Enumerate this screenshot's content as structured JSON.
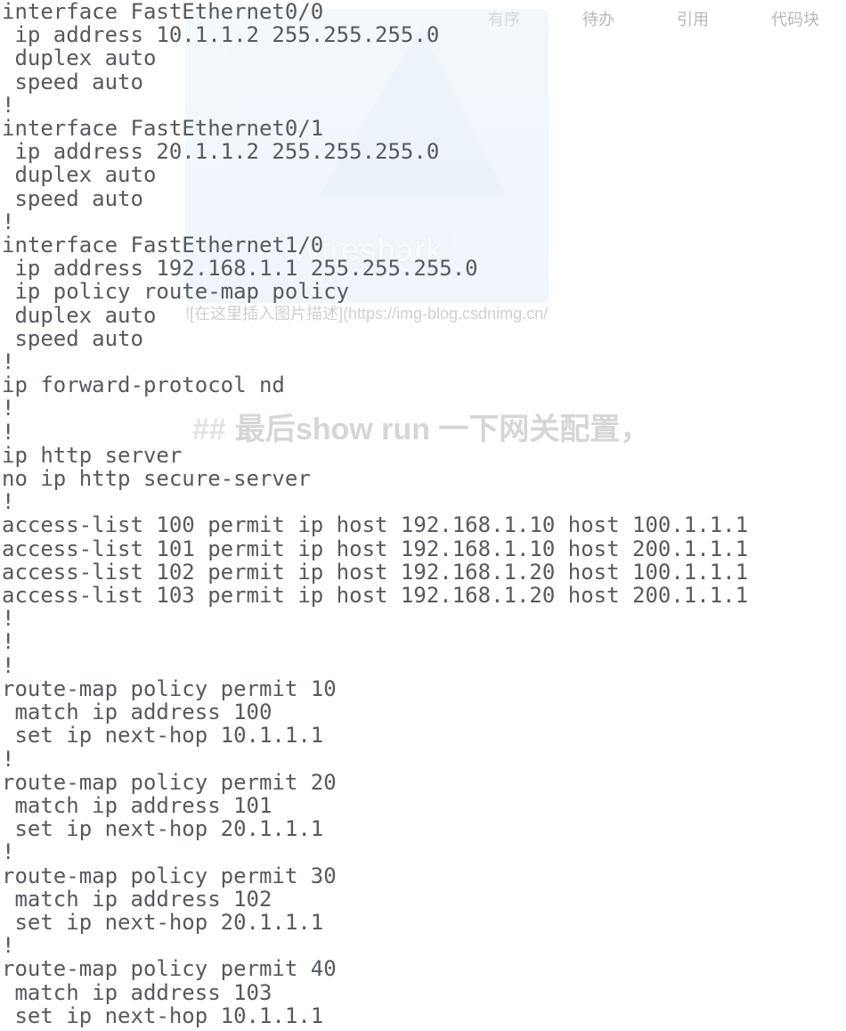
{
  "toolbar": {
    "items": [
      "有序",
      "待办",
      "引用",
      "代码块"
    ]
  },
  "wireshark": {
    "label": "Wireshark"
  },
  "watermark_image_text": "![在这里插入图片描述](https://img-blog.csdnimg.cn/",
  "watermark_heading_hashes": "##",
  "watermark_heading_text": "最后show run 一下网关配置，",
  "config_text": "interface FastEthernet0/0\n ip address 10.1.1.2 255.255.255.0\n duplex auto\n speed auto\n!\ninterface FastEthernet0/1\n ip address 20.1.1.2 255.255.255.0\n duplex auto\n speed auto\n!\ninterface FastEthernet1/0\n ip address 192.168.1.1 255.255.255.0\n ip policy route-map policy\n duplex auto\n speed auto\n!\nip forward-protocol nd\n!\n!\nip http server\nno ip http secure-server\n!\naccess-list 100 permit ip host 192.168.1.10 host 100.1.1.1\naccess-list 101 permit ip host 192.168.1.10 host 200.1.1.1\naccess-list 102 permit ip host 192.168.1.20 host 100.1.1.1\naccess-list 103 permit ip host 192.168.1.20 host 200.1.1.1\n!\n!\n!\nroute-map policy permit 10\n match ip address 100\n set ip next-hop 10.1.1.1\n!\nroute-map policy permit 20\n match ip address 101\n set ip next-hop 20.1.1.1\n!\nroute-map policy permit 30\n match ip address 102\n set ip next-hop 20.1.1.1\n!\nroute-map policy permit 40\n match ip address 103\n set ip next-hop 10.1.1.1",
  "config": {
    "interfaces": [
      {
        "name": "FastEthernet0/0",
        "ip": "10.1.1.2",
        "mask": "255.255.255.0",
        "duplex": "auto",
        "speed": "auto"
      },
      {
        "name": "FastEthernet0/1",
        "ip": "20.1.1.2",
        "mask": "255.255.255.0",
        "duplex": "auto",
        "speed": "auto"
      },
      {
        "name": "FastEthernet1/0",
        "ip": "192.168.1.1",
        "mask": "255.255.255.0",
        "policy": "route-map policy",
        "duplex": "auto",
        "speed": "auto"
      }
    ],
    "global": [
      "ip forward-protocol nd",
      "ip http server",
      "no ip http secure-server"
    ],
    "access_lists": [
      {
        "id": 100,
        "action": "permit",
        "proto": "ip",
        "src": "192.168.1.10",
        "dst": "100.1.1.1"
      },
      {
        "id": 101,
        "action": "permit",
        "proto": "ip",
        "src": "192.168.1.10",
        "dst": "200.1.1.1"
      },
      {
        "id": 102,
        "action": "permit",
        "proto": "ip",
        "src": "192.168.1.20",
        "dst": "100.1.1.1"
      },
      {
        "id": 103,
        "action": "permit",
        "proto": "ip",
        "src": "192.168.1.20",
        "dst": "200.1.1.1"
      }
    ],
    "route_maps": [
      {
        "name": "policy",
        "seq": 10,
        "match_acl": 100,
        "next_hop": "10.1.1.1"
      },
      {
        "name": "policy",
        "seq": 20,
        "match_acl": 101,
        "next_hop": "20.1.1.1"
      },
      {
        "name": "policy",
        "seq": 30,
        "match_acl": 102,
        "next_hop": "20.1.1.1"
      },
      {
        "name": "policy",
        "seq": 40,
        "match_acl": 103,
        "next_hop": "10.1.1.1"
      }
    ]
  }
}
